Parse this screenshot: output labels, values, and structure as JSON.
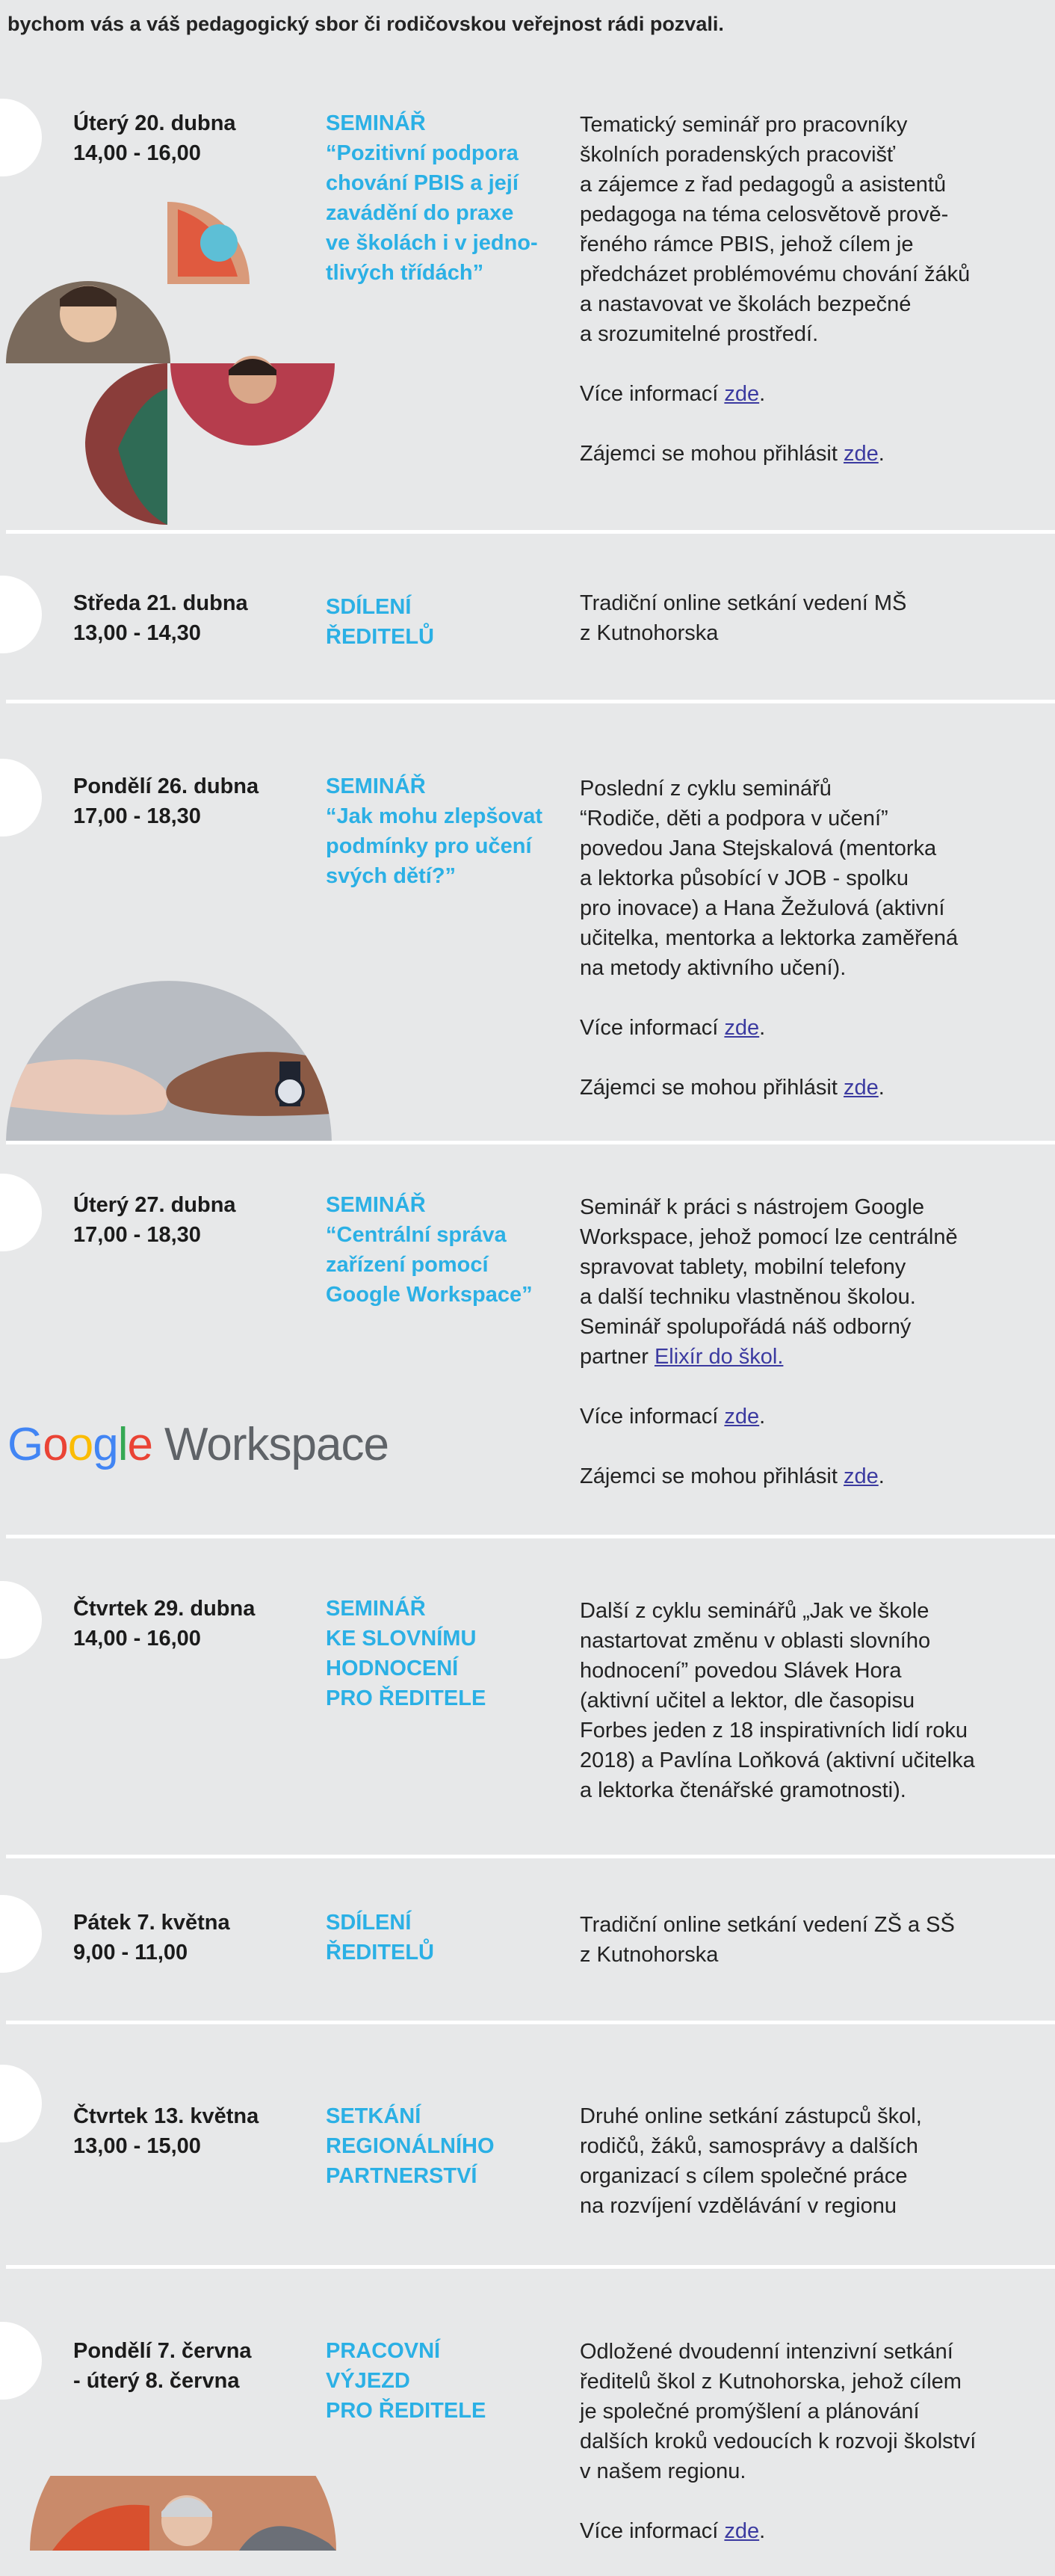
{
  "intro_text": "bychom vás a váš pedagogický sbor či rodičovskou veřejnost rádi pozvali.",
  "events": [
    {
      "date": [
        "Úterý 20. dubna",
        "14,00 - 16,00"
      ],
      "title": [
        "SEMINÁŘ",
        "“Pozitivní podpora",
        "chování PBIS a její",
        "zavádění do praxe",
        "ve školách i v jedno-",
        "tlivých třídách”"
      ],
      "desc": [
        "Tematický seminář pro pracovníky",
        "školních poradenských pracovišť",
        "a zájemce z řad pedagogů a asistentů",
        "pedagoga na téma celosvětově prově-",
        "řeného rámce PBIS, jehož cílem je",
        "předcházet problémovému chování žáků",
        "a nastavovat ve školách bezpečné",
        "a srozumitelné prostředí."
      ],
      "more_prefix": "Více informací ",
      "more_link": "zde",
      "signup_prefix": "Zájemci se mohou přihlásit ",
      "signup_link": "zde"
    },
    {
      "date": [
        "Středa 21. dubna",
        "13,00 - 14,30"
      ],
      "title": [
        "SDÍLENÍ",
        "ŘEDITELŮ"
      ],
      "desc": [
        "Tradiční online setkání vedení MŠ",
        "z Kutnohorska"
      ]
    },
    {
      "date": [
        "Pondělí 26. dubna",
        "17,00 - 18,30"
      ],
      "title": [
        "SEMINÁŘ",
        "“Jak mohu zlepšovat",
        "podmínky pro učení",
        "svých dětí?”"
      ],
      "desc": [
        "Poslední z cyklu seminářů",
        "“Rodiče, děti a podpora v učení”",
        "povedou Jana Stejskalová (mentorka",
        "a lektorka působící v JOB - spolku",
        "pro inovace) a Hana Žežulová (aktivní",
        "učitelka, mentorka a lektorka zaměřená",
        "na metody aktivního učení)."
      ],
      "more_prefix": "Více informací ",
      "more_link": "zde",
      "signup_prefix": "Zájemci se mohou přihlásit ",
      "signup_link": "zde"
    },
    {
      "date": [
        "Úterý 27. dubna",
        "17,00 - 18,30"
      ],
      "title": [
        "SEMINÁŘ",
        "“Centrální správa",
        "zařízení pomocí",
        "Google Workspace”"
      ],
      "desc": [
        "Seminář k práci s nástrojem Google",
        "Workspace, jehož pomocí lze centrálně",
        "spravovat tablety, mobilní telefony",
        "a další techniku vlastněnou školou.",
        "Seminář spolupořádá náš odborný"
      ],
      "desc_last_prefix": "partner ",
      "desc_last_link": "Elixír do škol.",
      "more_prefix": "Více informací ",
      "more_link": "zde",
      "signup_prefix": "Zájemci se mohou přihlásit ",
      "signup_link": "zde"
    },
    {
      "date": [
        "Čtvrtek 29. dubna",
        "14,00 - 16,00"
      ],
      "title": [
        "SEMINÁŘ",
        "KE SLOVNÍMU",
        "HODNOCENÍ",
        "PRO ŘEDITELE"
      ],
      "desc": [
        "Další z cyklu seminářů „Jak ve škole",
        "nastartovat změnu v oblasti slovního",
        "hodnocení” povedou Slávek Hora",
        "(aktivní učitel a lektor, dle časopisu",
        "Forbes jeden z 18 inspirativních lidí roku",
        "2018) a Pavlína Loňková (aktivní učitelka",
        "a lektorka čtenářské gramotnosti)."
      ]
    },
    {
      "date": [
        "Pátek 7. května",
        "9,00 - 11,00"
      ],
      "title": [
        "SDÍLENÍ",
        "ŘEDITELŮ"
      ],
      "desc": [
        "Tradiční online setkání vedení ZŠ a SŠ",
        "z Kutnohorska"
      ]
    },
    {
      "date": [
        "Čtvrtek 13. května",
        "13,00 - 15,00"
      ],
      "title": [
        "SETKÁNÍ",
        "REGIONÁLNÍHO",
        "PARTNERSTVÍ"
      ],
      "desc": [
        "Druhé online setkání zástupců škol,",
        "rodičů, žáků, samosprávy a dalších",
        "organizací s cílem společné práce",
        "na rozvíjení vzdělávání v regionu"
      ]
    },
    {
      "date": [
        "Pondělí 7. června",
        "- úterý 8. června"
      ],
      "title": [
        "PRACOVNÍ",
        "VÝJEZD",
        "PRO ŘEDITELE"
      ],
      "desc": [
        "Odložené dvoudenní intenzivní setkání",
        "ředitelů škol z Kutnohorska, jehož cílem",
        "je společné promýšlení a plánování",
        "dalších kroků vedoucích k rozvoji školství",
        "v našem regionu."
      ],
      "more_prefix": "Více informací ",
      "more_link": "zde"
    }
  ],
  "google_workspace_logo": {
    "letters": [
      "G",
      "o",
      "o",
      "g",
      "l",
      "e"
    ],
    "word": "Workspace"
  },
  "colors": {
    "background": "#e7e8e9",
    "title_blue": "#2bb0e5",
    "link": "#3b3aa0",
    "tab_white": "#ffffff"
  }
}
